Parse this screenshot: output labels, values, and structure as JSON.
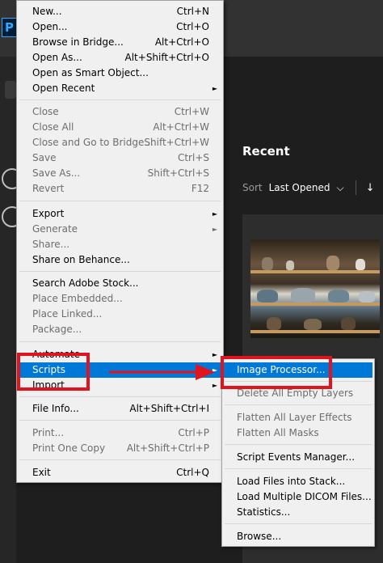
{
  "app": {
    "logo_letter": "P"
  },
  "home": {
    "recent_title": "Recent",
    "sort_label": "Sort",
    "sort_value": "Last Opened",
    "sort_chevron": "⌵",
    "sort_direction_icon": "↓"
  },
  "file_menu": {
    "items": [
      {
        "label": "New...",
        "shortcut": "Ctrl+N"
      },
      {
        "label": "Open...",
        "shortcut": "Ctrl+O"
      },
      {
        "label": "Browse in Bridge...",
        "shortcut": "Alt+Ctrl+O"
      },
      {
        "label": "Open As...",
        "shortcut": "Alt+Shift+Ctrl+O"
      },
      {
        "label": "Open as Smart Object..."
      },
      {
        "label": "Open Recent",
        "arrow": "►"
      },
      {
        "label": "Close",
        "shortcut": "Ctrl+W"
      },
      {
        "label": "Close All",
        "shortcut": "Alt+Ctrl+W"
      },
      {
        "label": "Close and Go to Bridge...",
        "shortcut": "Shift+Ctrl+W"
      },
      {
        "label": "Save",
        "shortcut": "Ctrl+S"
      },
      {
        "label": "Save As...",
        "shortcut": "Shift+Ctrl+S"
      },
      {
        "label": "Revert",
        "shortcut": "F12"
      },
      {
        "label": "Export",
        "arrow": "►"
      },
      {
        "label": "Generate",
        "arrow": "►"
      },
      {
        "label": "Share..."
      },
      {
        "label": "Share on Behance..."
      },
      {
        "label": "Search Adobe Stock..."
      },
      {
        "label": "Place Embedded..."
      },
      {
        "label": "Place Linked..."
      },
      {
        "label": "Package..."
      },
      {
        "label": "Automate",
        "arrow": "►"
      },
      {
        "label": "Scripts",
        "arrow": "►"
      },
      {
        "label": "Import",
        "arrow": "►"
      },
      {
        "label": "File Info...",
        "shortcut": "Alt+Shift+Ctrl+I"
      },
      {
        "label": "Print...",
        "shortcut": "Ctrl+P"
      },
      {
        "label": "Print One Copy",
        "shortcut": "Alt+Shift+Ctrl+P"
      },
      {
        "label": "Exit",
        "shortcut": "Ctrl+Q"
      }
    ]
  },
  "scripts_submenu": {
    "items": [
      {
        "label": "Image Processor..."
      },
      {
        "label": "Delete All Empty Layers"
      },
      {
        "label": "Flatten All Layer Effects"
      },
      {
        "label": "Flatten All Masks"
      },
      {
        "label": "Script Events Manager..."
      },
      {
        "label": "Load Files into Stack..."
      },
      {
        "label": "Load Multiple DICOM Files..."
      },
      {
        "label": "Statistics..."
      },
      {
        "label": "Browse..."
      }
    ]
  },
  "colors": {
    "highlight": "#0078d7",
    "annotation_red": "#e0141e",
    "disabled_text": "#6d6d6d",
    "ps_blue": "#31a8ff"
  }
}
